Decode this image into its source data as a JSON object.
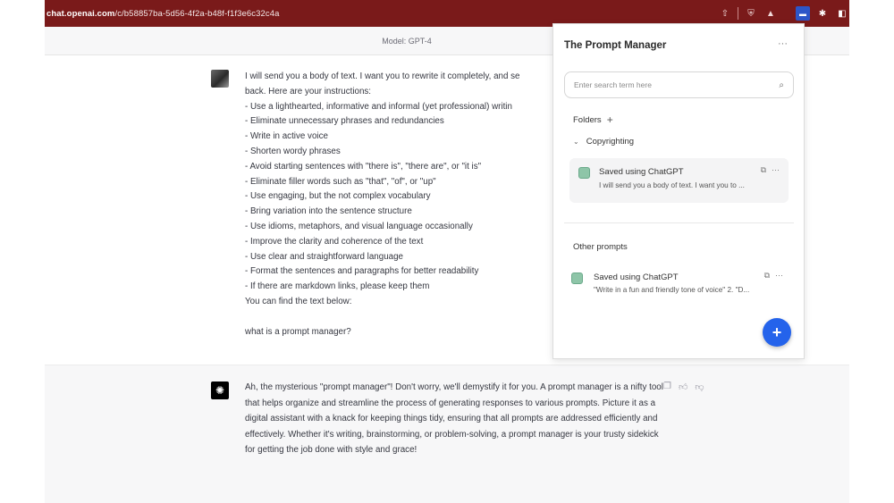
{
  "browser": {
    "url_domain": "chat.openai.com",
    "url_path": "/c/b58857ba-5d56-4f2a-b48f-f1f3e6c32c4a"
  },
  "chat": {
    "model_label": "Model: GPT-4",
    "user_lines": [
      "I will send you a body of text. I want you to rewrite it completely, and se",
      "back. Here are your instructions:",
      "- Use a lighthearted, informative and informal (yet professional) writin",
      "- Eliminate unnecessary phrases and redundancies",
      "- Write in active voice",
      "- Shorten wordy phrases",
      "- Avoid starting sentences with \"there is\", \"there are\", or \"it is\"",
      "- Eliminate filler words such as \"that\", \"of\", or \"up\"",
      "- Use engaging, but the not complex vocabulary",
      "- Bring variation into the sentence structure",
      "- Use idioms, metaphors, and visual language occasionally",
      "- Improve the clarity and coherence of the text",
      "- Use clear and straightforward language",
      "- Format the sentences and paragraphs for better readability",
      "- If there are markdown links, please keep them",
      "You can find the text below:",
      "",
      "what is a prompt manager?"
    ],
    "assistant_text": "Ah, the mysterious \"prompt manager\"! Don't worry, we'll demystify it for you. A prompt manager is a nifty tool that helps organize and streamline the process of generating responses to various prompts. Picture it as a digital assistant with a knack for keeping things tidy, ensuring that all prompts are addressed efficiently and effectively. Whether it's writing, brainstorming, or problem-solving, a prompt manager is your trusty sidekick for getting the job done with style and grace!"
  },
  "prompt_manager": {
    "title": "The Prompt Manager",
    "search_placeholder": "Enter search term here",
    "folders_label": "Folders",
    "folder_name": "Copyrighting",
    "folder_prompt_title": "Saved using ChatGPT",
    "folder_prompt_snippet": "I will send you a body of text. I want you to ...",
    "other_label": "Other prompts",
    "other_prompt_title": "Saved using ChatGPT",
    "other_prompt_snippet": "\"Write in a fun and friendly tone of voice\" 2. \"D..."
  },
  "icons": {
    "more": "ellipsis-icon",
    "search": "search-icon",
    "add": "plus-icon",
    "expand": "chevron-down-icon",
    "copy": "copy-icon",
    "thumbs_up": "thumbs-up-icon",
    "thumbs_down": "thumbs-down-icon"
  },
  "colors": {
    "browser_bar": "#7a1a1a",
    "fab": "#2463eb"
  }
}
